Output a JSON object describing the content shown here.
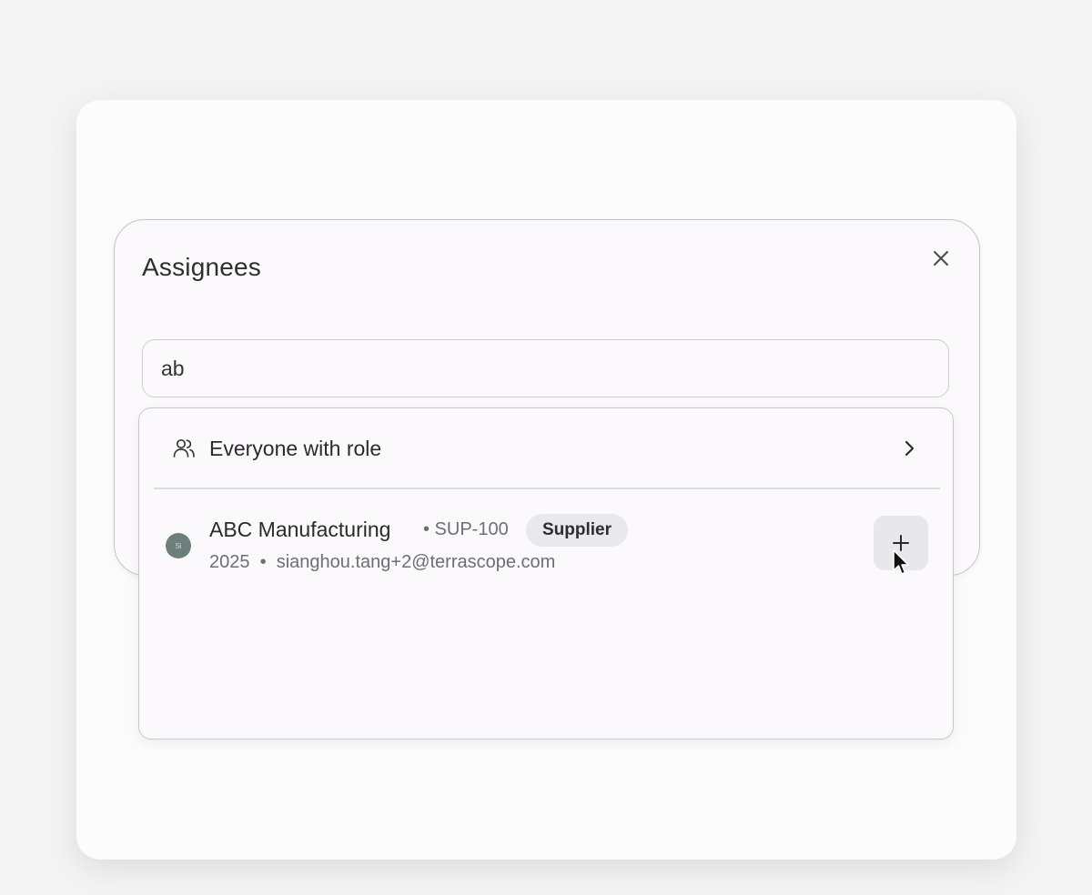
{
  "dialog": {
    "title": "Assignees",
    "close_icon": "close-icon"
  },
  "search": {
    "value": "ab",
    "icon": "none"
  },
  "dropdown": {
    "role_option": {
      "icon": "users-icon",
      "label": "Everyone with role",
      "chevron_icon": "chevron-right-icon"
    },
    "results": [
      {
        "avatar_initials": "Si",
        "name": "ABC Manufacturing",
        "code": "• SUP-100",
        "badge": "Supplier",
        "meta": "2025  •  sianghou.tang+2@terrascope.com",
        "action_icon": "plus-icon"
      }
    ]
  },
  "colors": {
    "page_bg": "#f4f4f4",
    "dialog_bg": "#fbf9fc",
    "border": "#c6c4cb",
    "badge_bg": "#e9e8ec",
    "avatar": "#6d7f7b"
  }
}
